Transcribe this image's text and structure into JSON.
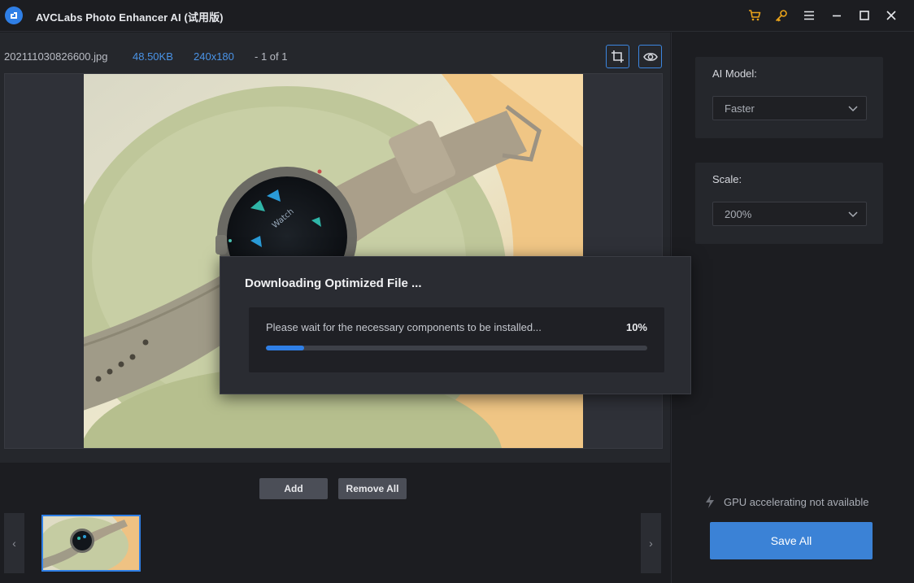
{
  "app": {
    "title": "AVCLabs Photo Enhancer AI (试用版)",
    "logo_icon": "avclabs-logo-icon"
  },
  "titlebar": {
    "icons": [
      "cart-icon",
      "key-icon",
      "menu-icon",
      "minimize-icon",
      "maximize-icon",
      "close-icon"
    ],
    "accent_color": "#e8a21a"
  },
  "file_info": {
    "name": "202111030826600.jpg",
    "size": "48.50KB",
    "dimensions": "240x180",
    "count": "- 1 of 1"
  },
  "preview_tools": {
    "crop_icon": "crop-icon",
    "eye_icon": "eye-icon"
  },
  "bottom": {
    "add_label": "Add",
    "remove_all_label": "Remove All",
    "prev_arrow": "‹",
    "next_arrow": "›"
  },
  "settings": {
    "ai_model_label": "AI Model:",
    "ai_model_value": "Faster",
    "scale_label": "Scale:",
    "scale_value": "200%"
  },
  "gpu": {
    "text": "GPU accelerating not available",
    "icon": "lightning-icon"
  },
  "save_all_label": "Save All",
  "dialog": {
    "title": "Downloading Optimized File ...",
    "message": "Please wait for the necessary components to be installed...",
    "percent_label": "10%",
    "progress": 0.1
  },
  "colors": {
    "accent_blue": "#2f7fe6",
    "link_blue": "#4a93e6",
    "save_button": "#3b82d6"
  }
}
